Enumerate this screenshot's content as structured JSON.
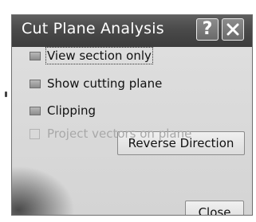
{
  "window": {
    "title": "Cut Plane Analysis",
    "help_glyph": "?",
    "close_icon": "close-x-icon"
  },
  "options": [
    {
      "label": "View section only",
      "state": "on",
      "focused": true
    },
    {
      "label": "Show cutting plane",
      "state": "on"
    },
    {
      "label": "Clipping",
      "state": "on"
    },
    {
      "label": "Project vectors on plane",
      "state": "disabled"
    }
  ],
  "buttons": {
    "reverse_direction": "Reverse Direction",
    "close": "Close"
  }
}
